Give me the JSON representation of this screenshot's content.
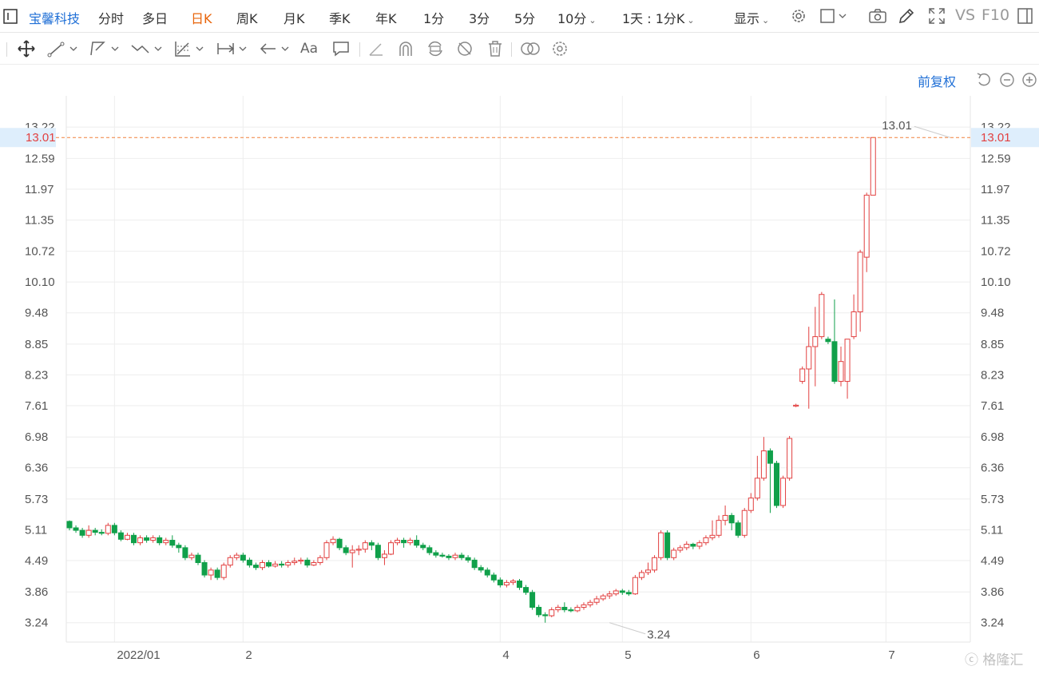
{
  "toolbar": {
    "stock_name": "宝馨科技",
    "periods": [
      "分时",
      "多日",
      "日K",
      "周K",
      "月K",
      "季K",
      "年K",
      "1分",
      "3分",
      "5分",
      "10分"
    ],
    "active_period": "日K",
    "multi_period": "1天 : 1分K",
    "display_label": "显示",
    "vs_label": "VS",
    "f10_label": "F10"
  },
  "controls": {
    "adjust_label": "前复权"
  },
  "colors": {
    "up": "#e24040",
    "down": "#10a04a",
    "dash": "#f0803c",
    "active": "#e8640a",
    "brand": "#1f6fd6"
  },
  "price_tags": {
    "left": "13.01",
    "right": "13.01"
  },
  "watermark": "格隆汇",
  "chart_data": {
    "type": "candlestick",
    "y_ticks": [
      "13.22",
      "12.59",
      "11.97",
      "11.35",
      "10.72",
      "10.10",
      "9.48",
      "8.85",
      "8.23",
      "7.61",
      "6.98",
      "6.36",
      "5.73",
      "5.11",
      "4.49",
      "3.86",
      "3.24"
    ],
    "y_range": [
      2.85,
      13.85
    ],
    "x_labels": [
      {
        "label": "2022/01",
        "index": 7
      },
      {
        "label": "2",
        "index": 27
      },
      {
        "label": "4",
        "index": 67
      },
      {
        "label": "5",
        "index": 86
      },
      {
        "label": "6",
        "index": 106
      },
      {
        "label": "7",
        "index": 127
      }
    ],
    "current_price": 13.01,
    "annotations": {
      "high": "13.01",
      "low": "3.24",
      "high_index": 137,
      "low_index": 84
    },
    "candles": [
      [
        5.28,
        5.15,
        5.3,
        5.1
      ],
      [
        5.15,
        5.1,
        5.2,
        5.05
      ],
      [
        5.1,
        5.0,
        5.15,
        4.95
      ],
      [
        5.0,
        5.1,
        5.2,
        4.95
      ],
      [
        5.1,
        5.06,
        5.15,
        5.0
      ],
      [
        5.06,
        5.04,
        5.12,
        5.0
      ],
      [
        5.04,
        5.2,
        5.25,
        5.0
      ],
      [
        5.2,
        5.05,
        5.25,
        5.0
      ],
      [
        5.05,
        4.92,
        5.1,
        4.88
      ],
      [
        4.92,
        5.0,
        5.05,
        4.9
      ],
      [
        5.0,
        4.85,
        5.05,
        4.8
      ],
      [
        4.85,
        4.95,
        5.0,
        4.8
      ],
      [
        4.95,
        4.9,
        5.0,
        4.85
      ],
      [
        4.9,
        4.95,
        5.0,
        4.85
      ],
      [
        4.95,
        4.85,
        5.0,
        4.8
      ],
      [
        4.85,
        4.9,
        4.95,
        4.8
      ],
      [
        4.9,
        4.8,
        5.0,
        4.75
      ],
      [
        4.8,
        4.75,
        4.85,
        4.65
      ],
      [
        4.75,
        4.55,
        4.8,
        4.5
      ],
      [
        4.55,
        4.6,
        4.65,
        4.5
      ],
      [
        4.6,
        4.45,
        4.65,
        4.4
      ],
      [
        4.45,
        4.2,
        4.5,
        4.15
      ],
      [
        4.2,
        4.3,
        4.35,
        4.1
      ],
      [
        4.3,
        4.15,
        4.35,
        4.1
      ],
      [
        4.15,
        4.4,
        4.45,
        4.1
      ],
      [
        4.4,
        4.55,
        4.6,
        4.35
      ],
      [
        4.55,
        4.6,
        4.65,
        4.5
      ],
      [
        4.6,
        4.5,
        4.65,
        4.45
      ],
      [
        4.5,
        4.4,
        4.55,
        4.35
      ],
      [
        4.4,
        4.35,
        4.45,
        4.3
      ],
      [
        4.35,
        4.45,
        4.5,
        4.3
      ],
      [
        4.45,
        4.38,
        4.5,
        4.35
      ],
      [
        4.38,
        4.42,
        4.48,
        4.35
      ],
      [
        4.42,
        4.4,
        4.48,
        4.35
      ],
      [
        4.4,
        4.45,
        4.5,
        4.35
      ],
      [
        4.45,
        4.48,
        4.55,
        4.4
      ],
      [
        4.48,
        4.5,
        4.55,
        4.42
      ],
      [
        4.5,
        4.4,
        4.55,
        4.35
      ],
      [
        4.4,
        4.45,
        4.5,
        4.38
      ],
      [
        4.45,
        4.55,
        4.6,
        4.4
      ],
      [
        4.55,
        4.85,
        4.9,
        4.5
      ],
      [
        4.85,
        4.92,
        4.98,
        4.8
      ],
      [
        4.92,
        4.75,
        4.95,
        4.7
      ],
      [
        4.75,
        4.65,
        4.8,
        4.6
      ],
      [
        4.65,
        4.7,
        4.8,
        4.35
      ],
      [
        4.7,
        4.72,
        4.8,
        4.6
      ],
      [
        4.72,
        4.85,
        4.9,
        4.65
      ],
      [
        4.85,
        4.8,
        4.9,
        4.7
      ],
      [
        4.8,
        4.55,
        4.85,
        4.5
      ],
      [
        4.55,
        4.62,
        4.7,
        4.4
      ],
      [
        4.62,
        4.85,
        4.9,
        4.6
      ],
      [
        4.85,
        4.9,
        4.95,
        4.8
      ],
      [
        4.9,
        4.85,
        4.95,
        4.75
      ],
      [
        4.85,
        4.9,
        4.95,
        4.8
      ],
      [
        4.9,
        4.8,
        5.0,
        4.75
      ],
      [
        4.8,
        4.75,
        4.85,
        4.7
      ],
      [
        4.75,
        4.65,
        4.8,
        4.6
      ],
      [
        4.65,
        4.6,
        4.7,
        4.55
      ],
      [
        4.6,
        4.58,
        4.65,
        4.55
      ],
      [
        4.58,
        4.55,
        4.62,
        4.5
      ],
      [
        4.55,
        4.6,
        4.65,
        4.5
      ],
      [
        4.6,
        4.55,
        4.65,
        4.5
      ],
      [
        4.55,
        4.5,
        4.6,
        4.45
      ],
      [
        4.5,
        4.35,
        4.55,
        4.3
      ],
      [
        4.35,
        4.3,
        4.4,
        4.25
      ],
      [
        4.3,
        4.2,
        4.35,
        4.15
      ],
      [
        4.2,
        4.1,
        4.25,
        4.05
      ],
      [
        4.1,
        4.0,
        4.15,
        3.95
      ],
      [
        4.0,
        4.05,
        4.1,
        3.95
      ],
      [
        4.05,
        4.08,
        4.12,
        4.0
      ],
      [
        4.08,
        3.95,
        4.12,
        3.9
      ],
      [
        3.95,
        3.85,
        4.0,
        3.8
      ],
      [
        3.85,
        3.55,
        3.9,
        3.5
      ],
      [
        3.55,
        3.4,
        3.6,
        3.35
      ],
      [
        3.4,
        3.38,
        3.45,
        3.24
      ],
      [
        3.38,
        3.5,
        3.55,
        3.35
      ],
      [
        3.5,
        3.55,
        3.6,
        3.45
      ],
      [
        3.55,
        3.5,
        3.65,
        3.45
      ],
      [
        3.5,
        3.48,
        3.55,
        3.45
      ],
      [
        3.48,
        3.55,
        3.6,
        3.45
      ],
      [
        3.55,
        3.6,
        3.65,
        3.5
      ],
      [
        3.6,
        3.65,
        3.7,
        3.55
      ],
      [
        3.65,
        3.72,
        3.78,
        3.6
      ],
      [
        3.72,
        3.78,
        3.82,
        3.68
      ],
      [
        3.78,
        3.82,
        3.88,
        3.72
      ],
      [
        3.82,
        3.88,
        3.92,
        3.78
      ],
      [
        3.88,
        3.85,
        3.92,
        3.8
      ],
      [
        3.85,
        3.82,
        3.9,
        3.78
      ],
      [
        3.82,
        4.15,
        4.2,
        3.8
      ],
      [
        4.15,
        4.25,
        4.3,
        4.1
      ],
      [
        4.25,
        4.3,
        4.45,
        4.2
      ],
      [
        4.3,
        4.55,
        4.6,
        4.25
      ],
      [
        4.55,
        5.05,
        5.1,
        4.5
      ],
      [
        5.05,
        4.55,
        5.1,
        4.5
      ],
      [
        4.55,
        4.7,
        4.75,
        4.5
      ],
      [
        4.7,
        4.75,
        4.8,
        4.65
      ],
      [
        4.75,
        4.82,
        4.88,
        4.7
      ],
      [
        4.82,
        4.78,
        4.85,
        4.72
      ],
      [
        4.78,
        4.85,
        4.9,
        4.72
      ],
      [
        4.85,
        4.95,
        5.0,
        4.8
      ],
      [
        4.95,
        5.0,
        5.3,
        4.9
      ],
      [
        5.0,
        5.3,
        5.4,
        4.95
      ],
      [
        5.3,
        5.4,
        5.6,
        5.2
      ],
      [
        5.4,
        5.25,
        5.45,
        5.1
      ],
      [
        5.25,
        5.0,
        5.3,
        4.95
      ],
      [
        5.0,
        5.5,
        5.55,
        4.95
      ],
      [
        5.5,
        5.75,
        5.85,
        5.45
      ],
      [
        5.75,
        6.15,
        6.6,
        5.7
      ],
      [
        6.15,
        6.7,
        6.98,
        6.1
      ],
      [
        6.7,
        6.45,
        6.75,
        5.45
      ],
      [
        6.45,
        5.6,
        6.5,
        5.55
      ],
      [
        5.6,
        6.15,
        6.2,
        5.55
      ],
      [
        6.15,
        6.95,
        7.0,
        6.1
      ],
      [
        7.6,
        7.62,
        7.65,
        7.58
      ],
      [
        8.1,
        8.35,
        8.4,
        8.05
      ],
      [
        8.35,
        8.8,
        9.2,
        7.55
      ],
      [
        8.8,
        9.0,
        9.6,
        8.0
      ],
      [
        9.0,
        9.85,
        9.9,
        8.95
      ],
      [
        8.95,
        8.9,
        9.0,
        8.85
      ],
      [
        8.9,
        8.1,
        9.75,
        8.05
      ],
      [
        8.1,
        8.5,
        8.8,
        8.0
      ],
      [
        8.1,
        8.95,
        8.95,
        7.75
      ],
      [
        9.0,
        9.5,
        9.85,
        8.95
      ],
      [
        9.5,
        10.7,
        10.75,
        9.1
      ],
      [
        10.6,
        11.85,
        11.9,
        10.3
      ],
      [
        11.85,
        13.01,
        13.01,
        11.85
      ]
    ]
  }
}
